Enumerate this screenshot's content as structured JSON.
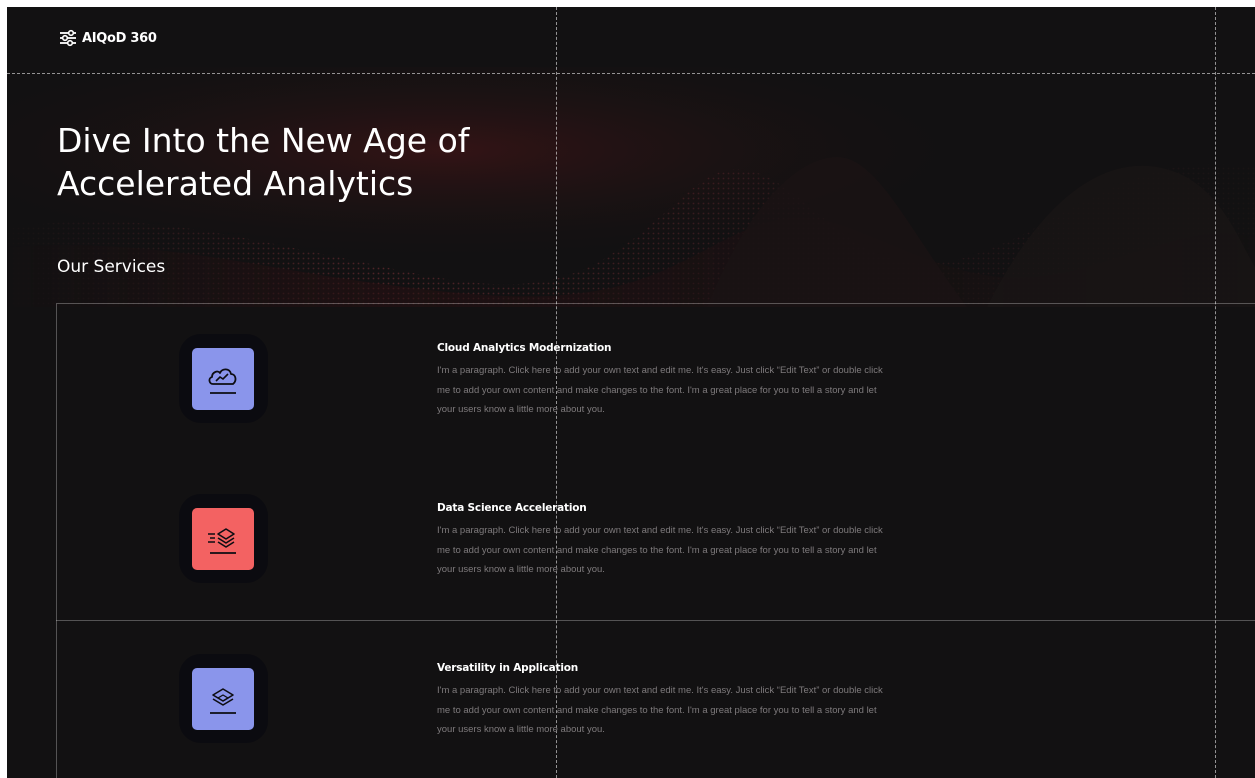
{
  "header": {
    "logo_text": "AIQoD 360",
    "logo_icon": "sliders-icon"
  },
  "hero": {
    "title_line1": "Dive Into the New Age of",
    "title_line2": "Accelerated Analytics"
  },
  "services": {
    "label": "Our Services",
    "items": [
      {
        "title": "Cloud Analytics Modernization",
        "text": "I'm a paragraph. Click here to add your own text and edit me. It's easy. Just click “Edit Text” or double click me to add your own content and make changes to the font. I'm a great place for you to tell a story and let your users know a little more about you.",
        "icon": "cloud-chart-icon",
        "color": "#8a95eb"
      },
      {
        "title": "Data Science Acceleration",
        "text": "I'm a paragraph. Click here to add your own text and edit me. It's easy. Just click “Edit Text” or double click me to add your own content and make changes to the font. I'm a great place for you to tell a story and let your users know a little more about you.",
        "icon": "layers-speed-icon",
        "color": "#f36262"
      },
      {
        "title": "Versatility in Application",
        "text": "I'm a paragraph. Click here to add your own text and edit me. It's easy. Just click “Edit Text” or double click me to add your own content and make changes to the font. I'm a great place for you to tell a story and let your users know a little more about you.",
        "icon": "stacked-layers-icon",
        "color": "#8a95eb"
      }
    ]
  }
}
